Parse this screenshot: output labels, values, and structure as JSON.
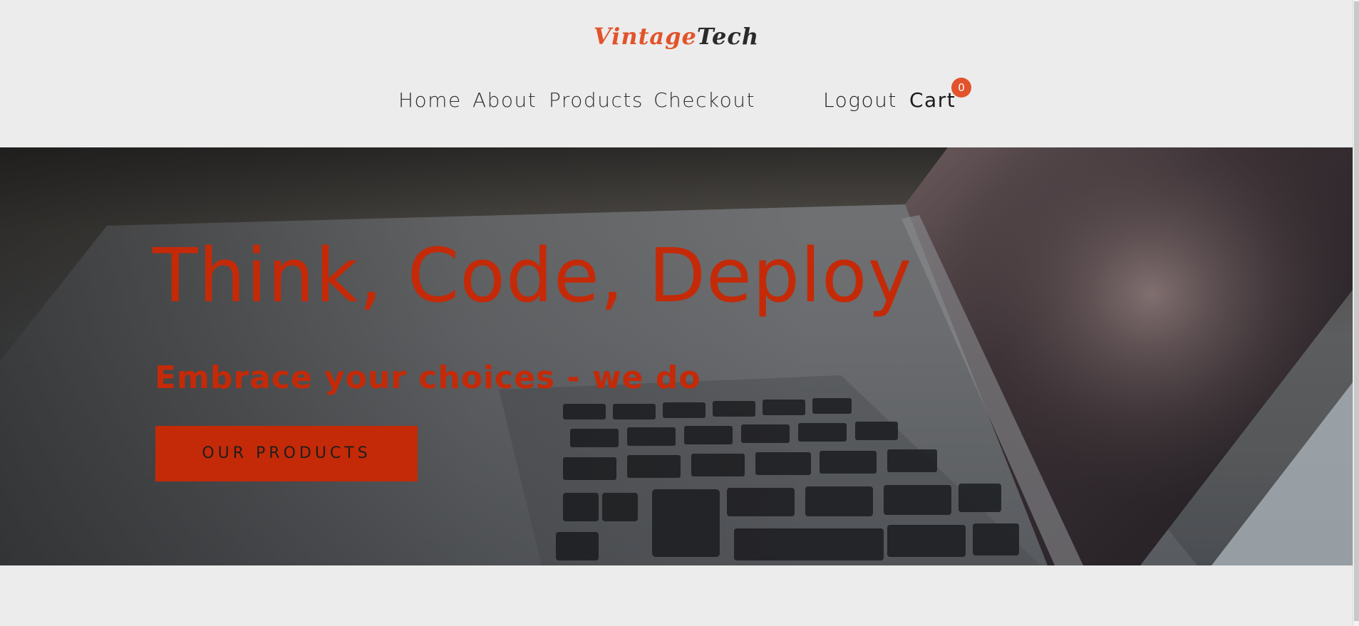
{
  "header": {
    "logo": {
      "part1": "Vintage",
      "part2": "Tech"
    },
    "nav": {
      "home": "Home",
      "about": "About",
      "products": "Products",
      "checkout": "Checkout",
      "logout": "Logout",
      "cart": "Cart",
      "cart_count": "0"
    }
  },
  "hero": {
    "title": "Think, Code, Deploy",
    "subtitle": "Embrace your choices - we do",
    "button": "OUR PRODUCTS"
  },
  "colors": {
    "accent": "#c42a08",
    "badge": "#e2532b",
    "background": "#ececec"
  },
  "icons": [
    "cart-badge"
  ]
}
